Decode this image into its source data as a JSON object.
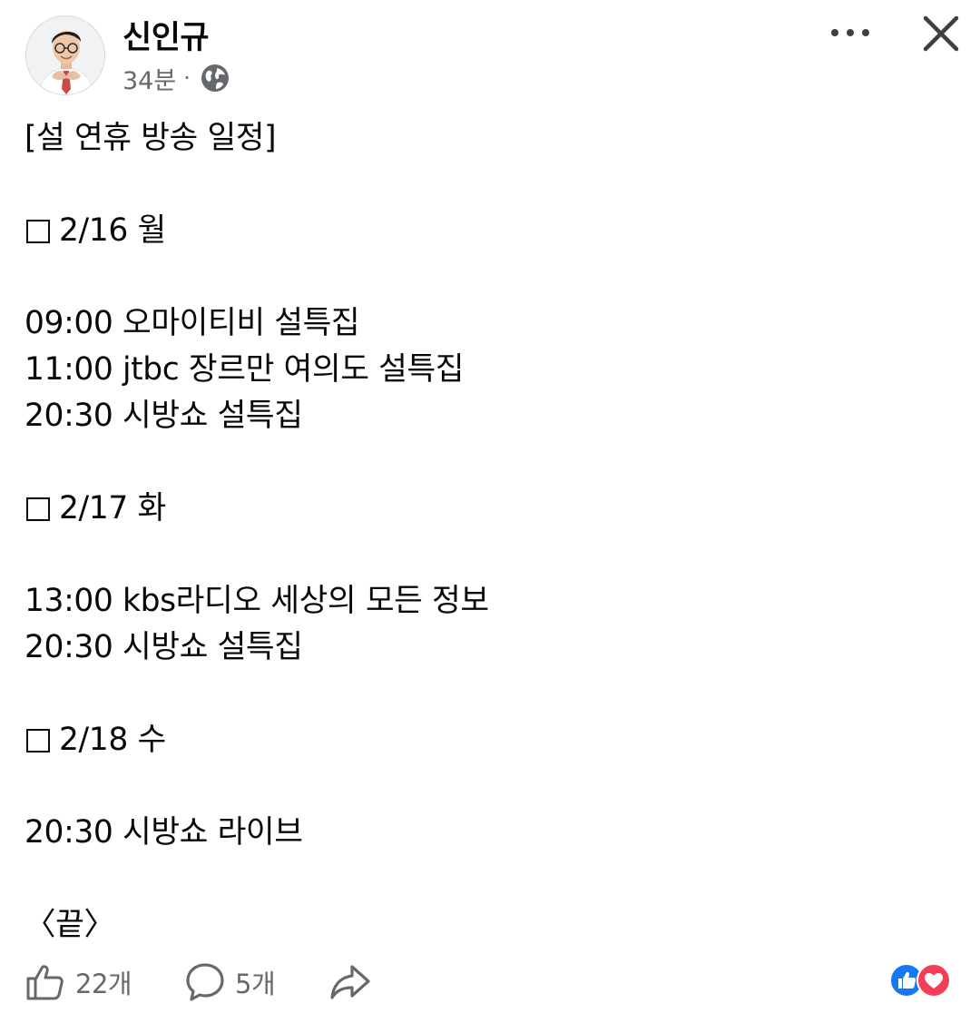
{
  "post": {
    "author_name": "신인규",
    "time": "34분",
    "separator": "·",
    "privacy_icon": "globe-icon",
    "lines": [
      "[설 연휴 방송 일정]",
      "",
      "2/16 월",
      "",
      "09:00 오마이티비 설특집",
      "11:00 jtbc 장르만 여의도 설특집",
      "20:30 시방쇼 설특집",
      "",
      "2/17 화",
      "",
      "13:00 kbs라디오 세상의 모든 정보",
      "20:30 시방쇼 설특집",
      "",
      "2/18 수",
      "",
      "20:30 시방쇼 라이브",
      "",
      "〈끝〉"
    ]
  },
  "header": {
    "more_icon": "more-horizontal-icon",
    "close_icon": "close-icon"
  },
  "actions": {
    "like_count": "22개",
    "comment_count": "5개",
    "like_icon": "thumbs-up-icon",
    "comment_icon": "comment-icon",
    "share_icon": "share-icon"
  },
  "reactions": {
    "icons": [
      "like-reaction-icon",
      "love-reaction-icon"
    ],
    "like_color": "#1877f2",
    "love_color": "#f33e58"
  },
  "colors": {
    "text": "#080809",
    "secondary_text": "#65686c"
  }
}
